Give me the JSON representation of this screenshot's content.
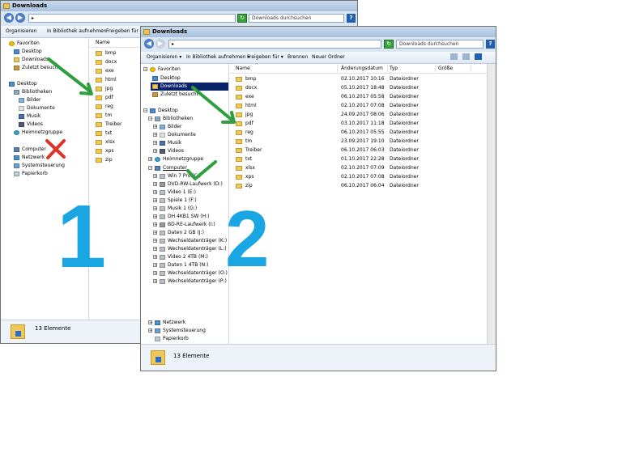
{
  "window1": {
    "title": "Downloads",
    "search_placeholder": "Downloads durchsuchen",
    "toolbar": {
      "organize": "Organisieren",
      "add_library": "In Bibliothek aufnehmen",
      "share": "Freigeben für"
    },
    "column_name": "Name",
    "nav": {
      "favorites": "Favoriten",
      "desktop_fav": "Desktop",
      "downloads": "Downloads",
      "recent": "Zuletzt besucht",
      "desktop": "Desktop",
      "libraries": "Bibliotheken",
      "pictures": "Bilder",
      "documents": "Dokumente",
      "music": "Musik",
      "videos": "Videos",
      "homegroup": "Heimnetzgruppe",
      "computer": "Computer",
      "network": "Netzwerk",
      "control_panel": "Systemsteuerung",
      "recycle_bin": "Papierkorb"
    },
    "files": [
      "bmp",
      "docx",
      "exe",
      "html",
      "jpg",
      "pdf",
      "reg",
      "tm",
      "Treiber",
      "txt",
      "xlsx",
      "xps",
      "zip"
    ],
    "item_count": "13 Elemente"
  },
  "window2": {
    "title": "Downloads",
    "search_placeholder": "Downloads durchsuchen",
    "toolbar": {
      "organize": "Organisieren ▾",
      "add_library": "In Bibliothek aufnehmen ▾",
      "share": "Freigeben für ▾",
      "burn": "Brennen",
      "new_folder": "Neuer Ordner"
    },
    "columns": {
      "name": "Name",
      "date": "Änderungsdatum",
      "type": "Typ",
      "size": "Größe"
    },
    "nav": {
      "favorites": "Favoriten",
      "desktop_fav": "Desktop",
      "downloads": "Downloads",
      "recent": "Zuletzt besucht",
      "desktop": "Desktop",
      "libraries": "Bibliotheken",
      "pictures": "Bilder",
      "documents": "Dokumente",
      "music": "Musik",
      "videos": "Videos",
      "homegroup": "Heimnetzgruppe",
      "computer": "Computer",
      "drives": [
        "Win 7 Pro (C:)",
        "DVD-RW-Laufwerk (D:)",
        "Video 1 (E:)",
        "Spiele 1 (F:)",
        "Musik 1 (G:)",
        "DH 4KB1 SW (H:)",
        "BD-RE-Laufwerk (I:)",
        "Daten 2 GB (J:)",
        "Wechseldatenträger (K:)",
        "Wechseldatenträger (L:)",
        "Video 2 4TB (M:)",
        "Daten 1 4TB (N:)",
        "Wechseldatenträger (O:)",
        "Wechseldatenträger (P:)"
      ],
      "network": "Netzwerk",
      "control_panel": "Systemsteuerung",
      "recycle_bin": "Papierkorb"
    },
    "rows": [
      {
        "name": "bmp",
        "date": "02.10.2017 10:16",
        "type": "Dateiordner"
      },
      {
        "name": "docx",
        "date": "05.10.2017 18:48",
        "type": "Dateiordner"
      },
      {
        "name": "exe",
        "date": "06.10.2017 05:58",
        "type": "Dateiordner"
      },
      {
        "name": "html",
        "date": "02.10.2017 07:08",
        "type": "Dateiordner"
      },
      {
        "name": "jpg",
        "date": "24.09.2017 08:06",
        "type": "Dateiordner"
      },
      {
        "name": "pdf",
        "date": "03.10.2017 11:18",
        "type": "Dateiordner"
      },
      {
        "name": "reg",
        "date": "06.10.2017 05:55",
        "type": "Dateiordner"
      },
      {
        "name": "tm",
        "date": "23.09.2017 19:10",
        "type": "Dateiordner"
      },
      {
        "name": "Treiber",
        "date": "06.10.2017 06:03",
        "type": "Dateiordner"
      },
      {
        "name": "txt",
        "date": "01.10.2017 22:28",
        "type": "Dateiordner"
      },
      {
        "name": "xlsx",
        "date": "02.10.2017 07:09",
        "type": "Dateiordner"
      },
      {
        "name": "xps",
        "date": "02.10.2017 07:08",
        "type": "Dateiordner"
      },
      {
        "name": "zip",
        "date": "06.10.2017 06:04",
        "type": "Dateiordner"
      }
    ],
    "item_count": "13 Elemente"
  },
  "annotations": {
    "label_1": "1",
    "label_2": "2",
    "arrow_color": "#2e9e3e",
    "cross_color": "#e0302a",
    "check_color": "#2e9e3e",
    "number_color": "#1aa5e3"
  }
}
